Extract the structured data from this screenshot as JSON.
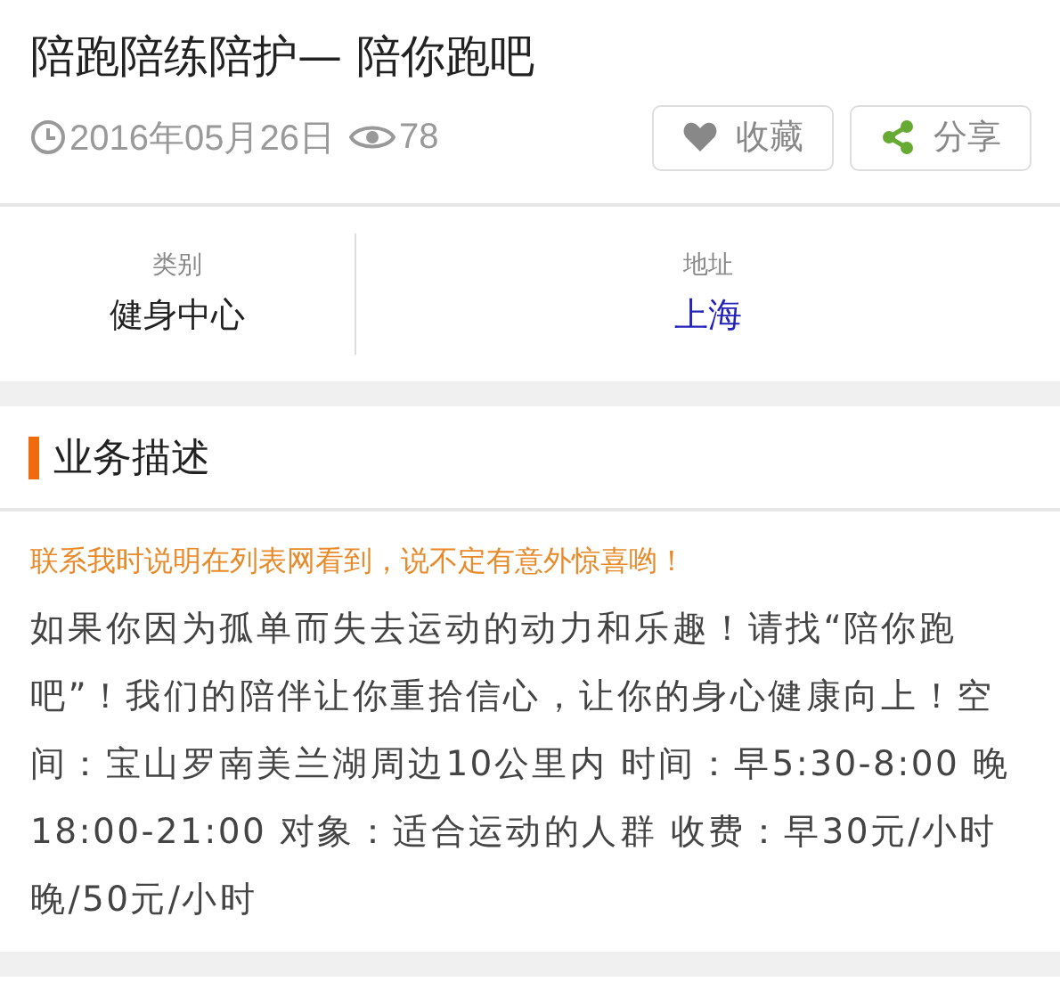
{
  "title": "陪跑陪练陪护— 陪你跑吧",
  "meta": {
    "date": "2016年05月26日",
    "views": "78"
  },
  "actions": [
    {
      "kind": "favorite",
      "label": "收藏"
    },
    {
      "kind": "share",
      "label": "分享"
    }
  ],
  "info": [
    {
      "label": "类别",
      "value": "健身中心",
      "kind": "text"
    },
    {
      "label": "地址",
      "value": "上海",
      "kind": "link"
    }
  ],
  "section": {
    "title": "业务描述",
    "notice": "联系我时说明在列表网看到，说不定有意外惊喜哟！",
    "body": "如果你因为孤单而失去运动的动力和乐趣！请找“陪你跑吧”！我们的陪伴让你重拾信心，让你的身心健康向上！空间：宝山罗南美兰湖周边10公里内 时间：早5:30-8:00 晚18:00-21:00 对象：适合运动的人群 收费：早30元/小时晚/50元/小时"
  }
}
